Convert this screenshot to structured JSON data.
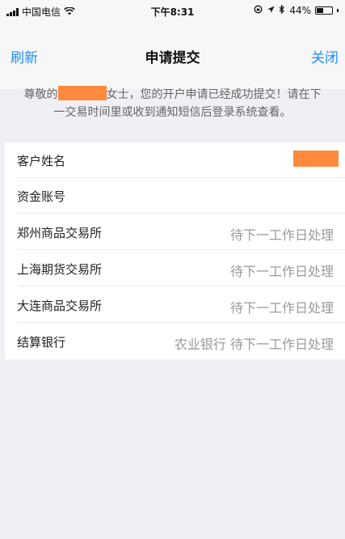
{
  "status_bar": {
    "carrier": "中国电信",
    "time": "下午8:31",
    "battery": "44%",
    "battery_level": 0.44
  },
  "nav": {
    "left": "刷新",
    "title": "申请提交",
    "right": "关闭"
  },
  "notice": {
    "prefix": "尊敬的",
    "line1_suffix": "女士，您的开户申请已经成功提交！请在下",
    "line2": "一交易时间里或收到通知短信后登录系统查看。"
  },
  "rows": [
    {
      "label": "客户姓名",
      "value": ""
    },
    {
      "label": "资金账号",
      "value": ""
    },
    {
      "label": "郑州商品交易所",
      "value": "待下一工作日处理"
    },
    {
      "label": "上海期货交易所",
      "value": "待下一工作日处理"
    },
    {
      "label": "大连商品交易所",
      "value": "待下一工作日处理"
    },
    {
      "label": "结算银行",
      "value": "农业银行 待下一工作日处理"
    }
  ]
}
